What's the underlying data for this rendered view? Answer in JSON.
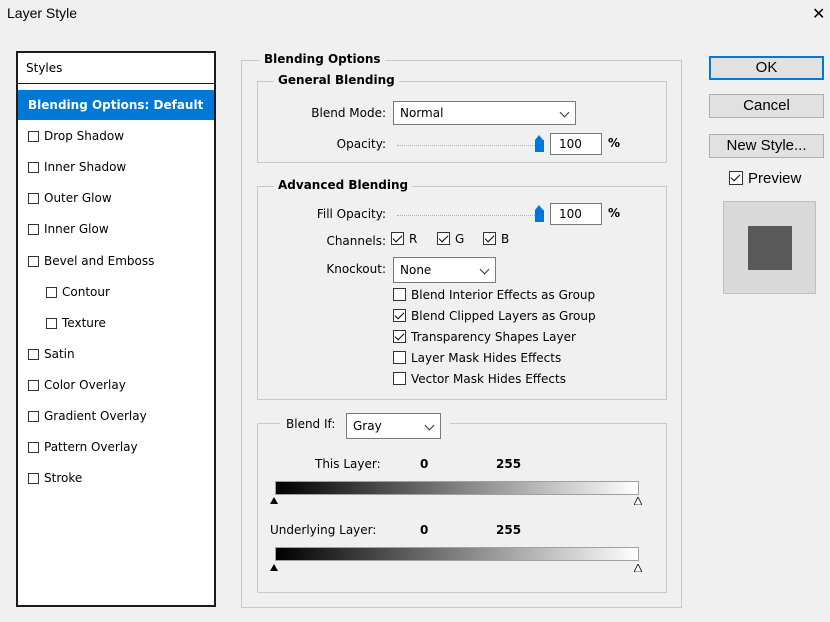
{
  "dialog": {
    "title": "Layer Style",
    "close_glyph": "✕"
  },
  "styles_panel": {
    "header": "Styles",
    "items": [
      {
        "label": "Blending Options: Default",
        "selected": true,
        "checkbox": false
      },
      {
        "label": "Drop Shadow",
        "checkbox": true,
        "checked": false
      },
      {
        "label": "Inner Shadow",
        "checkbox": true,
        "checked": false
      },
      {
        "label": "Outer Glow",
        "checkbox": true,
        "checked": false
      },
      {
        "label": "Inner Glow",
        "checkbox": true,
        "checked": false
      },
      {
        "label": "Bevel and Emboss",
        "checkbox": true,
        "checked": false
      },
      {
        "label": "Contour",
        "checkbox": true,
        "checked": false,
        "indent": true
      },
      {
        "label": "Texture",
        "checkbox": true,
        "checked": false,
        "indent": true
      },
      {
        "label": "Satin",
        "checkbox": true,
        "checked": false
      },
      {
        "label": "Color Overlay",
        "checkbox": true,
        "checked": false
      },
      {
        "label": "Gradient Overlay",
        "checkbox": true,
        "checked": false
      },
      {
        "label": "Pattern Overlay",
        "checkbox": true,
        "checked": false
      },
      {
        "label": "Stroke",
        "checkbox": true,
        "checked": false
      }
    ]
  },
  "blending": {
    "section_title": "Blending Options",
    "general": {
      "title": "General Blending",
      "blend_mode_label": "Blend Mode:",
      "blend_mode_value": "Normal",
      "opacity_label": "Opacity:",
      "opacity_value": "100",
      "opacity_unit": "%"
    },
    "advanced": {
      "title": "Advanced Blending",
      "fill_opacity_label": "Fill Opacity:",
      "fill_opacity_value": "100",
      "fill_opacity_unit": "%",
      "channels_label": "Channels:",
      "channels": [
        {
          "label": "R",
          "checked": true
        },
        {
          "label": "G",
          "checked": true
        },
        {
          "label": "B",
          "checked": true
        }
      ],
      "knockout_label": "Knockout:",
      "knockout_value": "None",
      "options": [
        {
          "label": "Blend Interior Effects as Group",
          "checked": false
        },
        {
          "label": "Blend Clipped Layers as Group",
          "checked": true
        },
        {
          "label": "Transparency Shapes Layer",
          "checked": true
        },
        {
          "label": "Layer Mask Hides Effects",
          "checked": false
        },
        {
          "label": "Vector Mask Hides Effects",
          "checked": false
        }
      ]
    },
    "blend_if": {
      "label": "Blend If:",
      "value": "Gray",
      "this_layer_label": "This Layer:",
      "this_layer_min": "0",
      "this_layer_max": "255",
      "underlying_label": "Underlying Layer:",
      "underlying_min": "0",
      "underlying_max": "255"
    }
  },
  "buttons": {
    "ok": "OK",
    "cancel": "Cancel",
    "new_style": "New Style...",
    "preview_label": "Preview",
    "preview_checked": true
  },
  "colors": {
    "accent": "#0078d7",
    "preview_swatch": "#595959"
  }
}
